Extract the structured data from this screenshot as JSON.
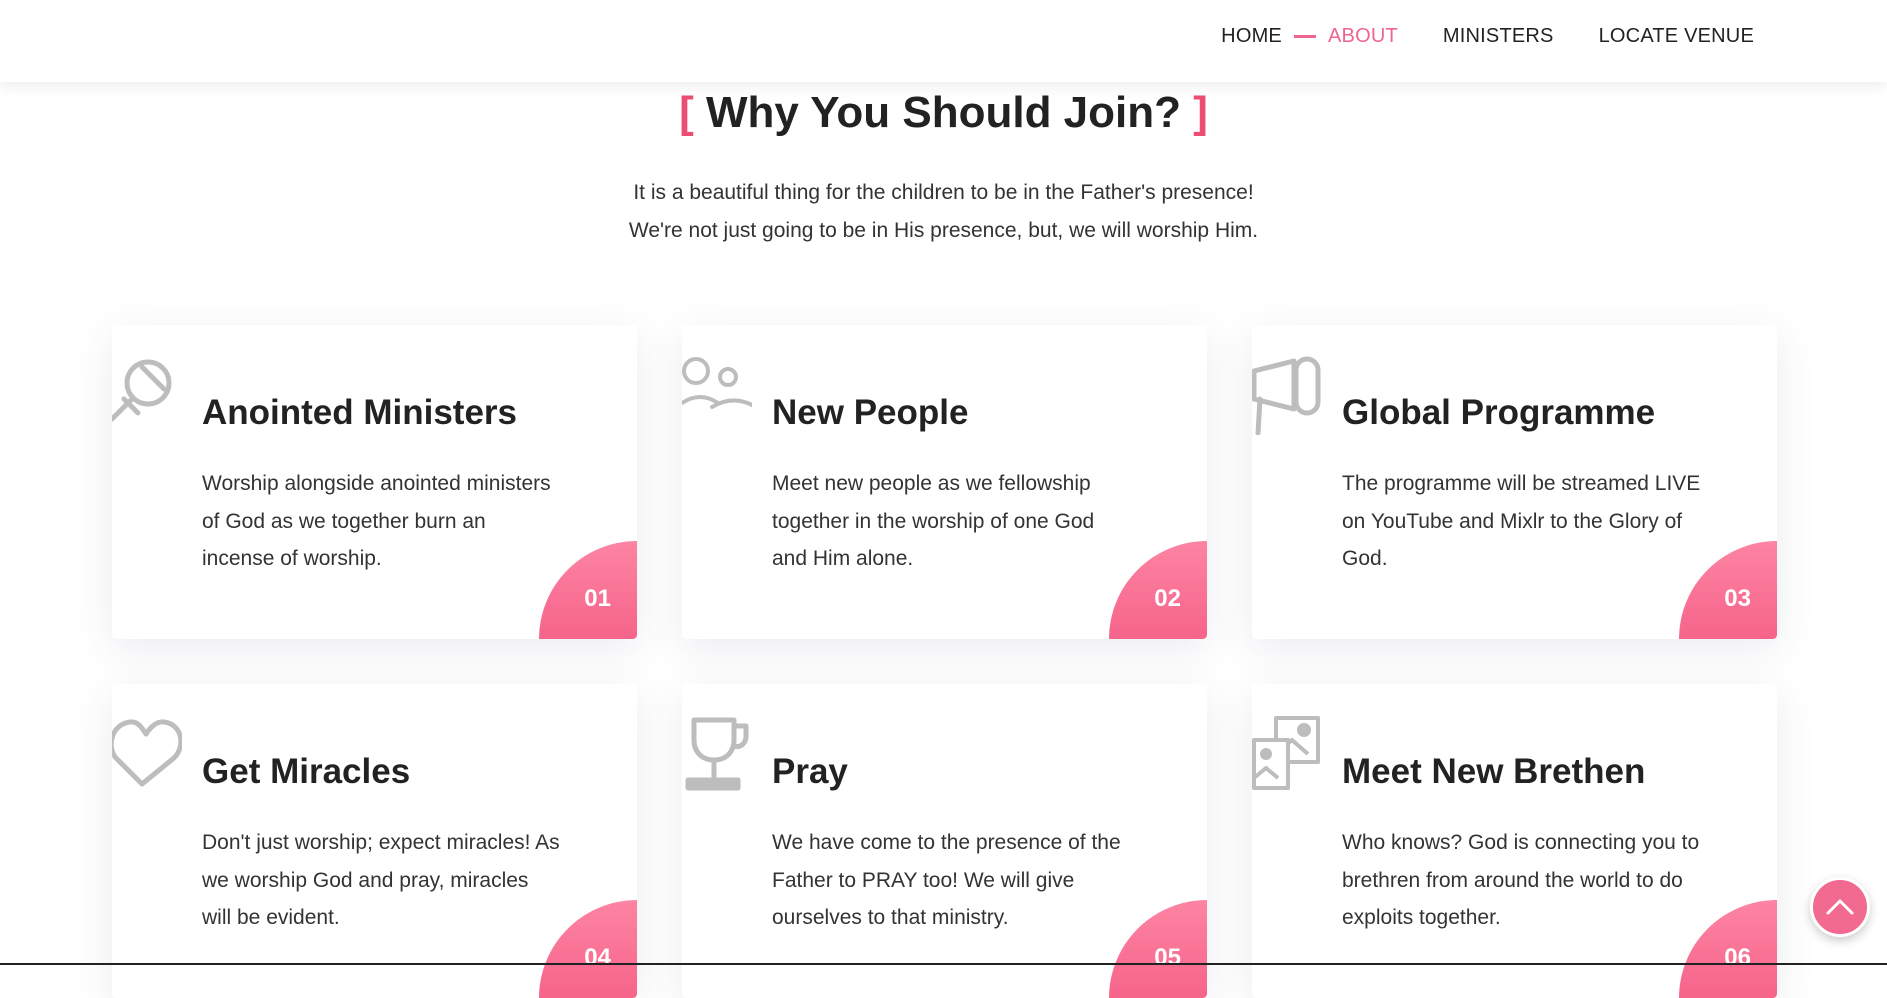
{
  "nav": {
    "items": [
      {
        "label": "HOME"
      },
      {
        "label": "ABOUT"
      },
      {
        "label": "MINISTERS"
      },
      {
        "label": "LOCATE VENUE"
      }
    ]
  },
  "section": {
    "bracket_open": "[",
    "title": "Why You Should Join?",
    "bracket_close": "]",
    "subtitle_line1": "It is a beautiful thing for the children to be in the Father's presence!",
    "subtitle_line2": "We're not just going to be in His presence, but, we will worship Him."
  },
  "cards": [
    {
      "icon": "microphone-icon",
      "title": "Anointed Ministers",
      "text": "Worship alongside anointed ministers of God as we together burn an incense of worship.",
      "number": "01"
    },
    {
      "icon": "people-icon",
      "title": "New People",
      "text": "Meet new people as we fellowship together in the worship of one God and Him alone.",
      "number": "02"
    },
    {
      "icon": "megaphone-icon",
      "title": "Global Programme",
      "text": "The programme will be streamed LIVE on YouTube and Mixlr to the Glory of God.",
      "number": "03"
    },
    {
      "icon": "heart-icon",
      "title": "Get Miracles",
      "text": "Don't just worship; expect miracles! As we worship God and pray, miracles will be evident.",
      "number": "04"
    },
    {
      "icon": "trophy-icon",
      "title": "Pray",
      "text": "We have come to the presence of the Father to PRAY too! We will give ourselves to that ministry.",
      "number": "05"
    },
    {
      "icon": "photos-icon",
      "title": "Meet New Brethen",
      "text": "Who knows? God is connecting you to brethren from around the world to do exploits together.",
      "number": "06"
    }
  ],
  "colors": {
    "accent": "#f0658f",
    "bracket": "#ec4d75",
    "badge": "#f6648a"
  },
  "scroll_top": {
    "icon": "chevron-up-icon"
  }
}
